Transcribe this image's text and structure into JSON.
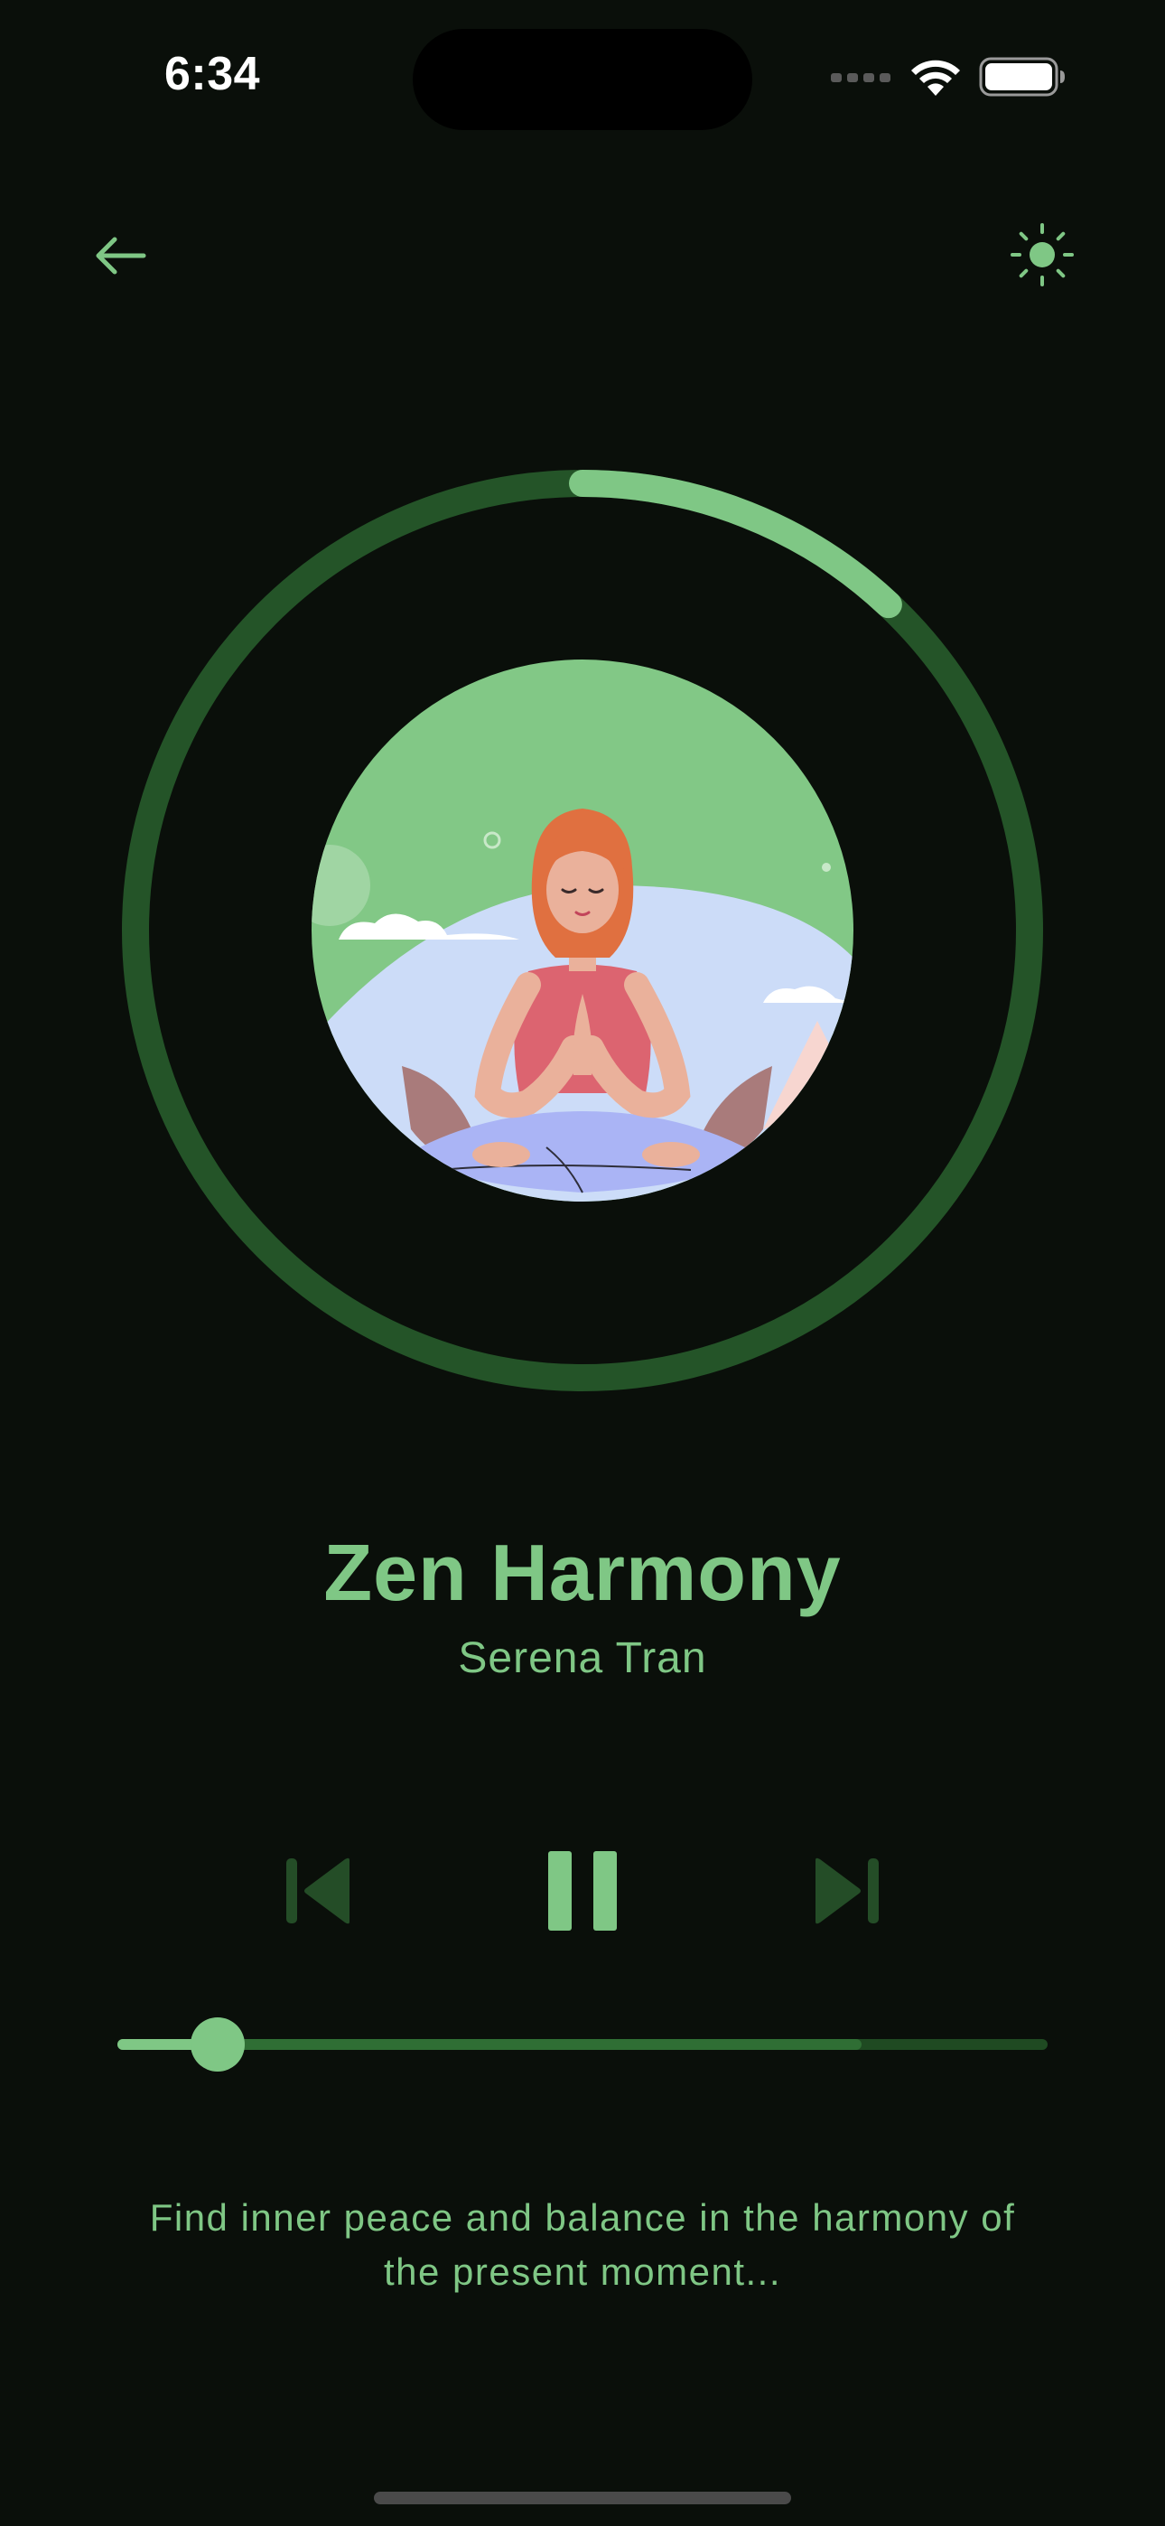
{
  "status_bar": {
    "time": "6:34",
    "icons": [
      "cellular-signal-icon",
      "wifi-icon",
      "battery-icon"
    ]
  },
  "header": {
    "back_icon": "arrow-left-icon",
    "theme_icon": "sun-icon"
  },
  "player": {
    "artwork_icon": "meditating-woman-illustration",
    "ring_progress": 0.12,
    "title": "Zen Harmony",
    "artist": "Serena Tran",
    "controls": {
      "previous_icon": "skip-previous-icon",
      "play_pause_icon": "pause-icon",
      "next_icon": "skip-next-icon"
    },
    "seek": {
      "played_fraction": 0.108,
      "buffered_fraction": 0.8
    },
    "description": "Find inner peace and balance in the harmony of the present moment..."
  },
  "colors": {
    "background": "#0a0f0a",
    "accent": "#7fc785",
    "ring_track": "#245428",
    "disabled_control": "#244d27"
  }
}
